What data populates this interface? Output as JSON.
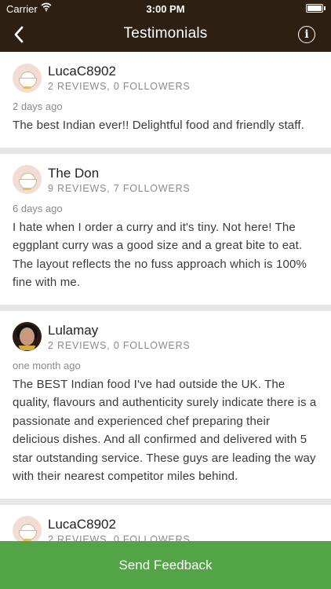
{
  "status_bar": {
    "carrier": "Carrier",
    "time": "3:00 PM"
  },
  "nav": {
    "title": "Testimonials",
    "back_icon": "chevron-left-icon",
    "info_icon": "info-icon"
  },
  "reviews": [
    {
      "name": "LucaC8902",
      "stats": "2 REVIEWS, 0 FOLLOWERS",
      "date": "2 days ago",
      "text": "The best Indian ever!! Delightful food and friendly staff."
    },
    {
      "name": "The Don",
      "stats": "9 REVIEWS, 7 FOLLOWERS",
      "date": "6 days ago",
      "text": "I hate when I order a curry and it's tiny. Not here! The eggplant curry was a good size and a great bite to eat. The layout reflects the no fuss approach which is 100% fine with me."
    },
    {
      "name": "Lulamay",
      "stats": "2 REVIEWS, 0 FOLLOWERS",
      "date": "one month ago",
      "text": "The BEST Indian food I've had outside the UK. The quality, flavours and authenticity surely indicate there is a passionate and experienced chef preparing their delicious dishes. And all confirmed and delivered with 5 star outstanding service. These guys are leading the way with their nearest competitor miles behind."
    },
    {
      "name": "LucaC8902",
      "stats": "2 REVIEWS, 0 FOLLOWERS",
      "date": "",
      "text": ""
    }
  ],
  "footer": {
    "send_label": "Send Feedback"
  },
  "colors": {
    "nav_bg": "#2d2013",
    "accent": "#52a447"
  }
}
